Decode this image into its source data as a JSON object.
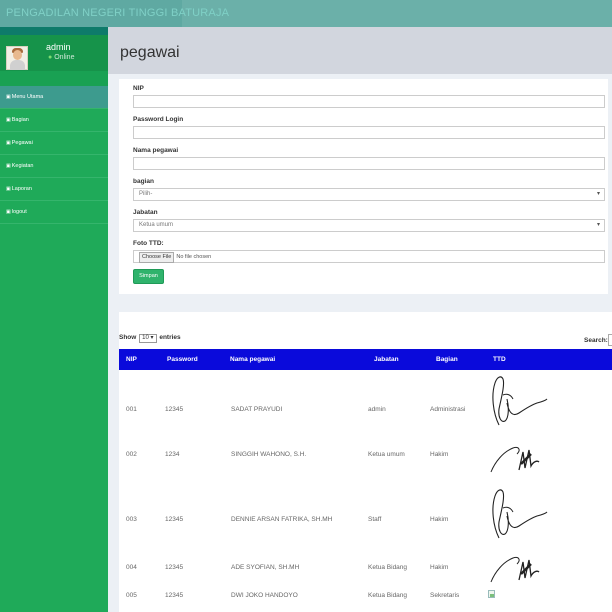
{
  "topbar": {
    "brand": "PENGADILAN NEGERI TINGGI BATURAJA"
  },
  "user": {
    "name": "admin",
    "status": "Online"
  },
  "menu": [
    {
      "label": "Menu Utama",
      "active": true
    },
    {
      "label": "Bagian",
      "active": false
    },
    {
      "label": "Pegawai",
      "active": false
    },
    {
      "label": "Kegiatan",
      "active": false
    },
    {
      "label": "Laporan",
      "active": false
    },
    {
      "label": "logout",
      "active": false
    }
  ],
  "page": {
    "title": "pegawai"
  },
  "form": {
    "nip_label": "NIP",
    "nip_value": "",
    "password_label": "Password Login",
    "password_value": "",
    "nama_label": "Nama pegawai",
    "nama_value": "",
    "bagian_label": "bagian",
    "bagian_selected": "Pilih-",
    "jabatan_label": "Jabatan",
    "jabatan_selected": "Ketua umum",
    "foto_label": "Foto TTD:",
    "file_button": "Choose File",
    "file_status": "No file chosen",
    "submit_label": "Simpan"
  },
  "table": {
    "show_label": "Show",
    "entries_value": "10",
    "entries_label": "entries",
    "search_label": "Search:",
    "columns": [
      "NIP",
      "Password",
      "Nama pegawai",
      "Jabatan",
      "Bagian",
      "TTD"
    ],
    "rows": [
      {
        "nip": "001",
        "password": "12345",
        "nama": "SADAT PRAYUDI",
        "jabatan": "admin",
        "bagian": "Administrasi",
        "ttd": "signature-a"
      },
      {
        "nip": "002",
        "password": "1234",
        "nama": "SINGGIH WAHONO, S.H.",
        "jabatan": "Ketua umum",
        "bagian": "Hakim",
        "ttd": "signature-b"
      },
      {
        "nip": "003",
        "password": "12345",
        "nama": "DENNIE ARSAN FATRIKA, SH.MH",
        "jabatan": "Staff",
        "bagian": "Hakim",
        "ttd": "signature-a"
      },
      {
        "nip": "004",
        "password": "12345",
        "nama": "ADE SYOFIAN, SH.MH",
        "jabatan": "Ketua Bidang",
        "bagian": "Hakim",
        "ttd": "signature-b"
      },
      {
        "nip": "005",
        "password": "12345",
        "nama": "DWI JOKO HANDOYO",
        "jabatan": "Ketua Bidang",
        "bagian": "Sekretaris",
        "ttd": "broken-image"
      }
    ]
  },
  "colors": {
    "sidebar": "#1faa59",
    "table_header": "#0a0adb",
    "topbar": "#5fa9a2",
    "button": "#2fb36c"
  }
}
